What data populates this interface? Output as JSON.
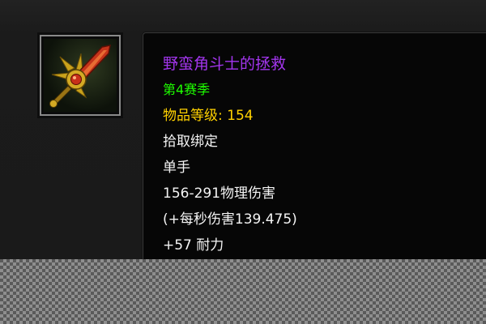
{
  "item": {
    "icon": "sword-icon",
    "name": "野蛮角斗士的拯救",
    "season": "第4赛季",
    "item_level_label": "物品等级: ",
    "item_level_value": "154",
    "binding": "拾取绑定",
    "slot": "单手",
    "damage": "156-291物理伤害",
    "dps": "(+每秒伤害139.475)",
    "stamina": "+57 耐力"
  },
  "colors": {
    "epic": "#a335ee",
    "season": "#1eff00",
    "item_level": "#ffd100",
    "text": "#f4f4f4"
  }
}
